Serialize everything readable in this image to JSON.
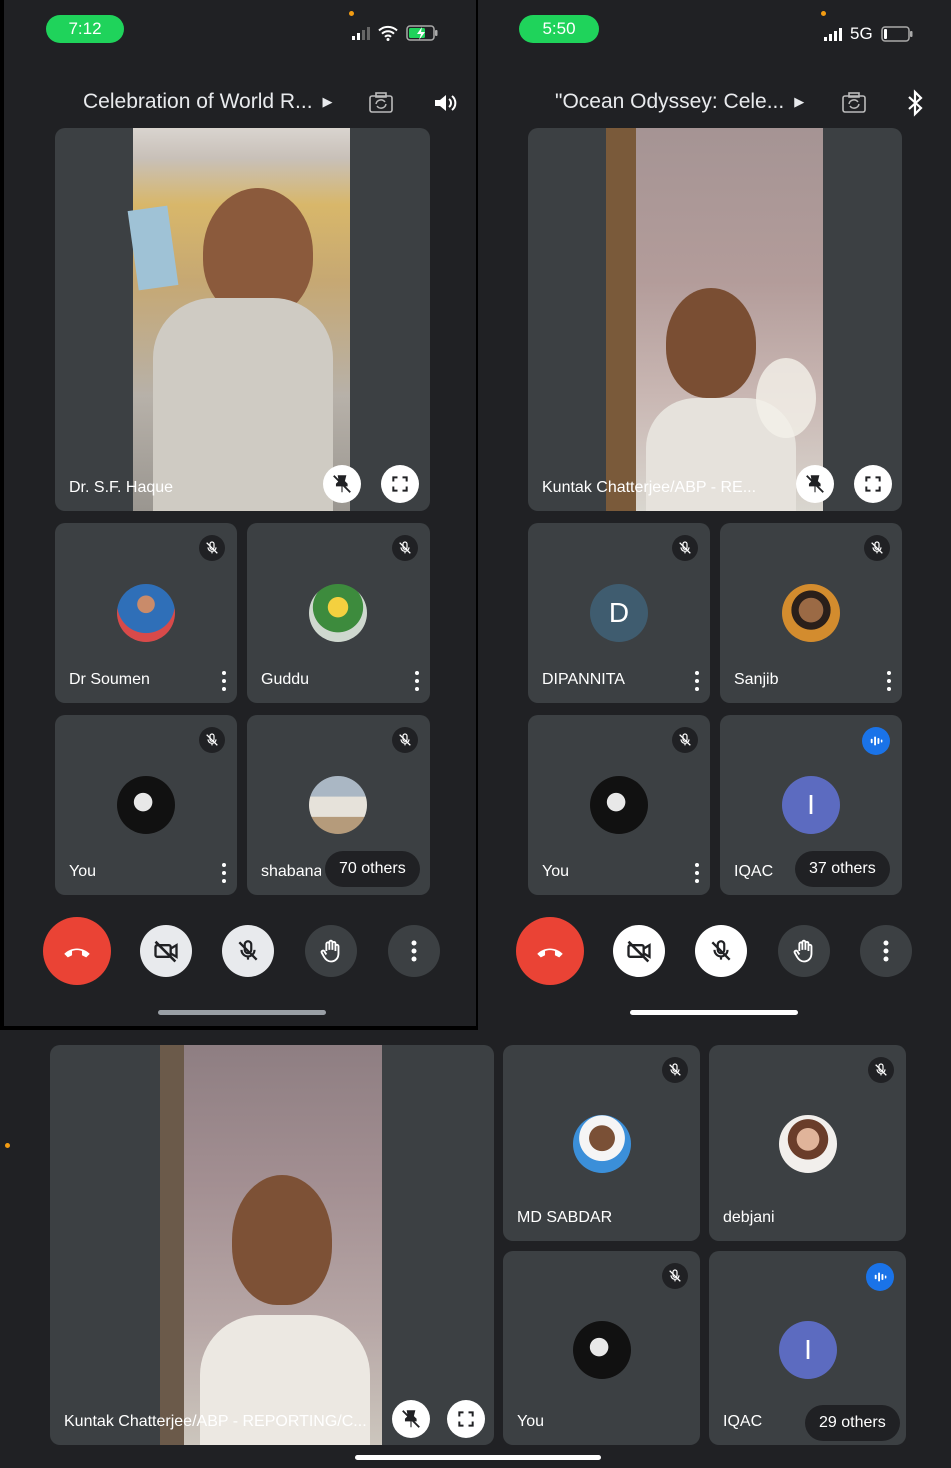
{
  "colors": {
    "accent_green": "#1fd35b",
    "hangup_red": "#ea4335",
    "speaking_blue": "#1a73e8",
    "tile_bg": "#3c4043"
  },
  "left_phone": {
    "status_time": "7:12",
    "meeting_title": "Celebration of World R...",
    "main_tile": {
      "name": "Dr. S.F. Haque"
    },
    "tiles": [
      {
        "name": "Dr Soumen"
      },
      {
        "name": "Guddu"
      },
      {
        "name": "You"
      },
      {
        "name": "shabana",
        "others": "70 others"
      }
    ],
    "icons": [
      "camera-switch-icon",
      "speaker-icon",
      "hangup-icon",
      "camera-off-icon",
      "mic-off-icon",
      "raise-hand-icon",
      "more-icon"
    ]
  },
  "right_phone": {
    "status_time": "5:50",
    "network": "5G",
    "meeting_title": "\"Ocean Odyssey: Cele...",
    "main_tile": {
      "name": "Kuntak Chatterjee/ABP - RE..."
    },
    "tiles": [
      {
        "name": "DIPANNITA",
        "initial": "D"
      },
      {
        "name": "Sanjib"
      },
      {
        "name": "You"
      },
      {
        "name": "IQAC",
        "initial": "I",
        "others": "37 others"
      }
    ],
    "icons": [
      "camera-switch-icon",
      "bluetooth-icon"
    ]
  },
  "bottom_tablet": {
    "main_tile": {
      "name": "Kuntak Chatterjee/ABP - REPORTING/C..."
    },
    "tiles": [
      {
        "name": "MD SABDAR"
      },
      {
        "name": "debjani"
      },
      {
        "name": "You"
      },
      {
        "name": "IQAC",
        "initial": "I",
        "others": "29 others"
      }
    ]
  }
}
